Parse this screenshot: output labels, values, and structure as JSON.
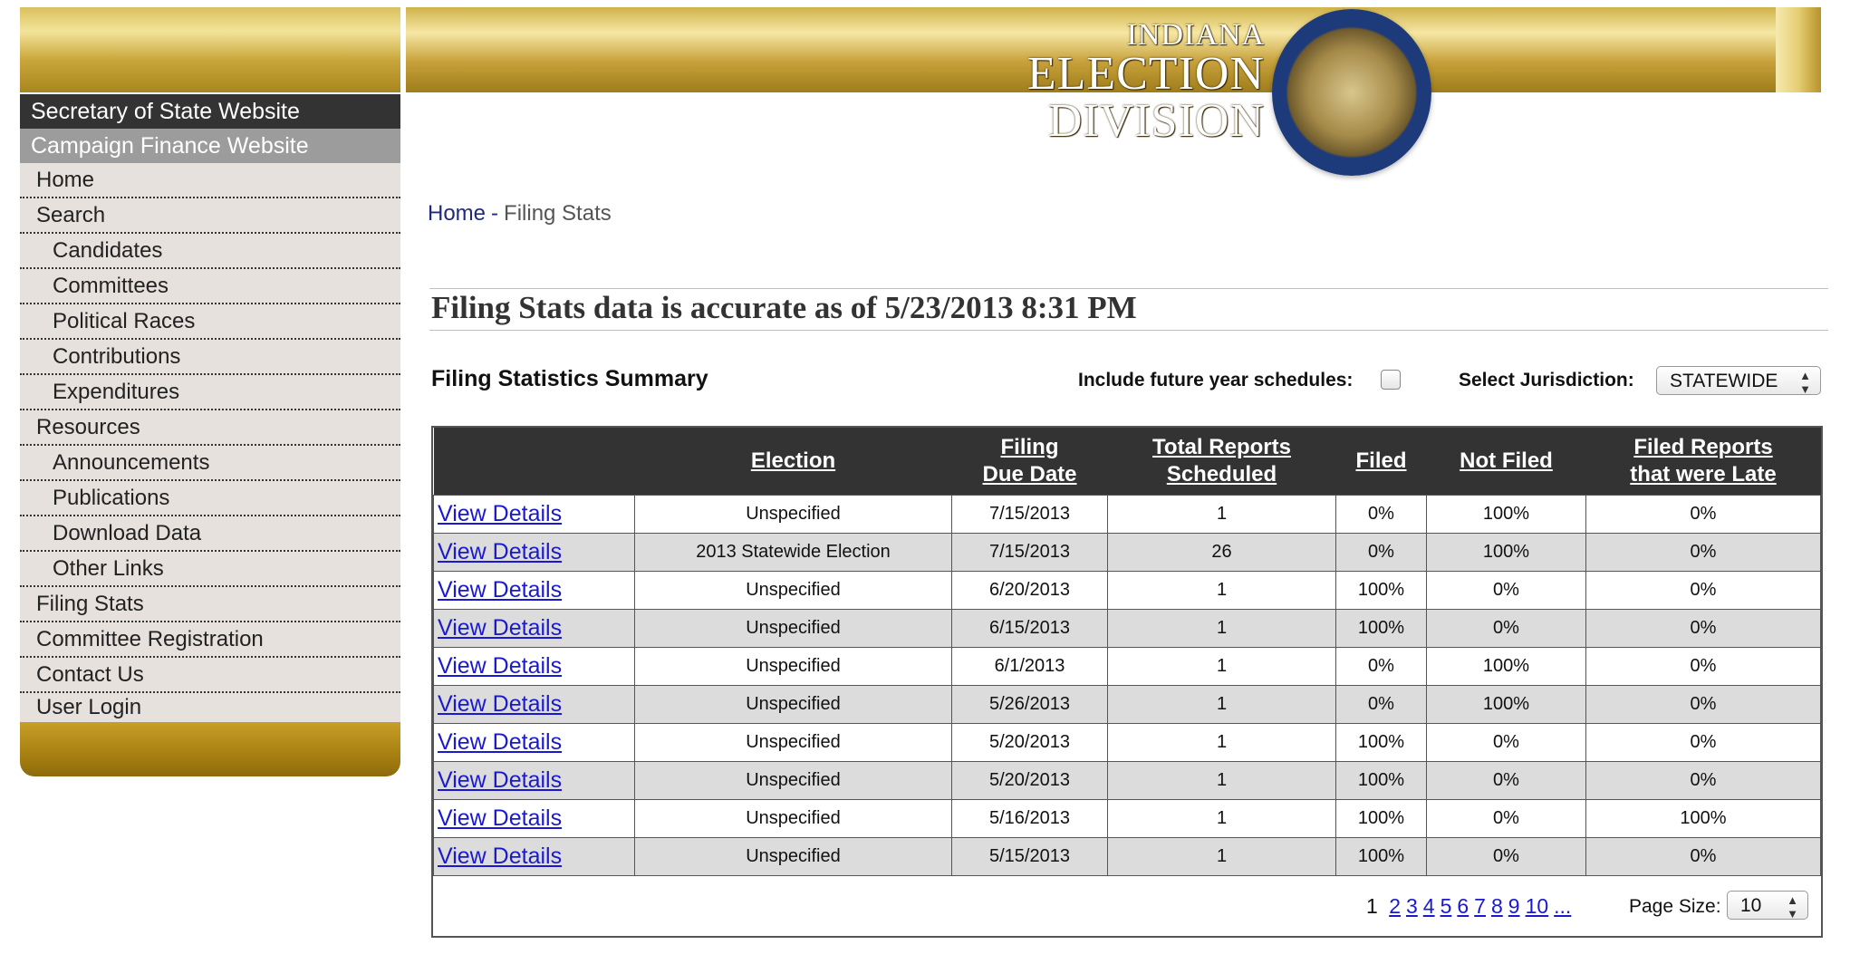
{
  "header": {
    "state": "INDIANA",
    "division": "ELECTION DIVISION"
  },
  "sidebar": {
    "top_links": [
      "Secretary of State Website",
      "Campaign Finance Website"
    ],
    "items": [
      {
        "label": "Home"
      },
      {
        "label": "Search"
      },
      {
        "label": "Candidates"
      },
      {
        "label": "Committees"
      },
      {
        "label": "Political Races"
      },
      {
        "label": "Contributions"
      },
      {
        "label": "Expenditures"
      },
      {
        "label": "Resources"
      },
      {
        "label": "Announcements"
      },
      {
        "label": "Publications"
      },
      {
        "label": "Download Data"
      },
      {
        "label": "Other Links"
      },
      {
        "label": "Filing Stats"
      },
      {
        "label": "Committee Registration"
      },
      {
        "label": "Contact Us"
      },
      {
        "label": "User Login"
      }
    ]
  },
  "breadcrumb": {
    "home": "Home",
    "separator": "-",
    "current": "Filing Stats"
  },
  "accuracy_text": "Filing Stats data is accurate as of 5/23/2013 8:31 PM",
  "summary": {
    "title": "Filing Statistics Summary",
    "future_label": "Include future year schedules:",
    "future_checked": false,
    "jurisdiction_label": "Select Jurisdiction:",
    "jurisdiction_value": "STATEWIDE"
  },
  "table": {
    "headers": [
      "",
      "Election",
      "Filing Due Date",
      "Total Reports Scheduled",
      "Filed",
      "Not Filed",
      "Filed Reports that were Late"
    ],
    "header_lines": [
      [
        ""
      ],
      [
        "Election"
      ],
      [
        "Filing",
        "Due Date"
      ],
      [
        "Total Reports",
        "Scheduled"
      ],
      [
        "Filed"
      ],
      [
        "Not Filed"
      ],
      [
        "Filed Reports",
        "that were Late"
      ]
    ],
    "rows": [
      {
        "link": "View Details",
        "election": "Unspecified",
        "due": "7/15/2013",
        "scheduled": "1",
        "filed": "0%",
        "not_filed": "100%",
        "late": "0%"
      },
      {
        "link": "View Details",
        "election": "2013 Statewide Election",
        "due": "7/15/2013",
        "scheduled": "26",
        "filed": "0%",
        "not_filed": "100%",
        "late": "0%"
      },
      {
        "link": "View Details",
        "election": "Unspecified",
        "due": "6/20/2013",
        "scheduled": "1",
        "filed": "100%",
        "not_filed": "0%",
        "late": "0%"
      },
      {
        "link": "View Details",
        "election": "Unspecified",
        "due": "6/15/2013",
        "scheduled": "1",
        "filed": "100%",
        "not_filed": "0%",
        "late": "0%"
      },
      {
        "link": "View Details",
        "election": "Unspecified",
        "due": "6/1/2013",
        "scheduled": "1",
        "filed": "0%",
        "not_filed": "100%",
        "late": "0%"
      },
      {
        "link": "View Details",
        "election": "Unspecified",
        "due": "5/26/2013",
        "scheduled": "1",
        "filed": "0%",
        "not_filed": "100%",
        "late": "0%"
      },
      {
        "link": "View Details",
        "election": "Unspecified",
        "due": "5/20/2013",
        "scheduled": "1",
        "filed": "100%",
        "not_filed": "0%",
        "late": "0%"
      },
      {
        "link": "View Details",
        "election": "Unspecified",
        "due": "5/20/2013",
        "scheduled": "1",
        "filed": "100%",
        "not_filed": "0%",
        "late": "0%"
      },
      {
        "link": "View Details",
        "election": "Unspecified",
        "due": "5/16/2013",
        "scheduled": "1",
        "filed": "100%",
        "not_filed": "0%",
        "late": "100%"
      },
      {
        "link": "View Details",
        "election": "Unspecified",
        "due": "5/15/2013",
        "scheduled": "1",
        "filed": "100%",
        "not_filed": "0%",
        "late": "0%"
      }
    ]
  },
  "pager": {
    "current": "1",
    "pages": [
      "2",
      "3",
      "4",
      "5",
      "6",
      "7",
      "8",
      "9",
      "10",
      "..."
    ],
    "page_size_label": "Page Size:",
    "page_size_value": "10"
  }
}
